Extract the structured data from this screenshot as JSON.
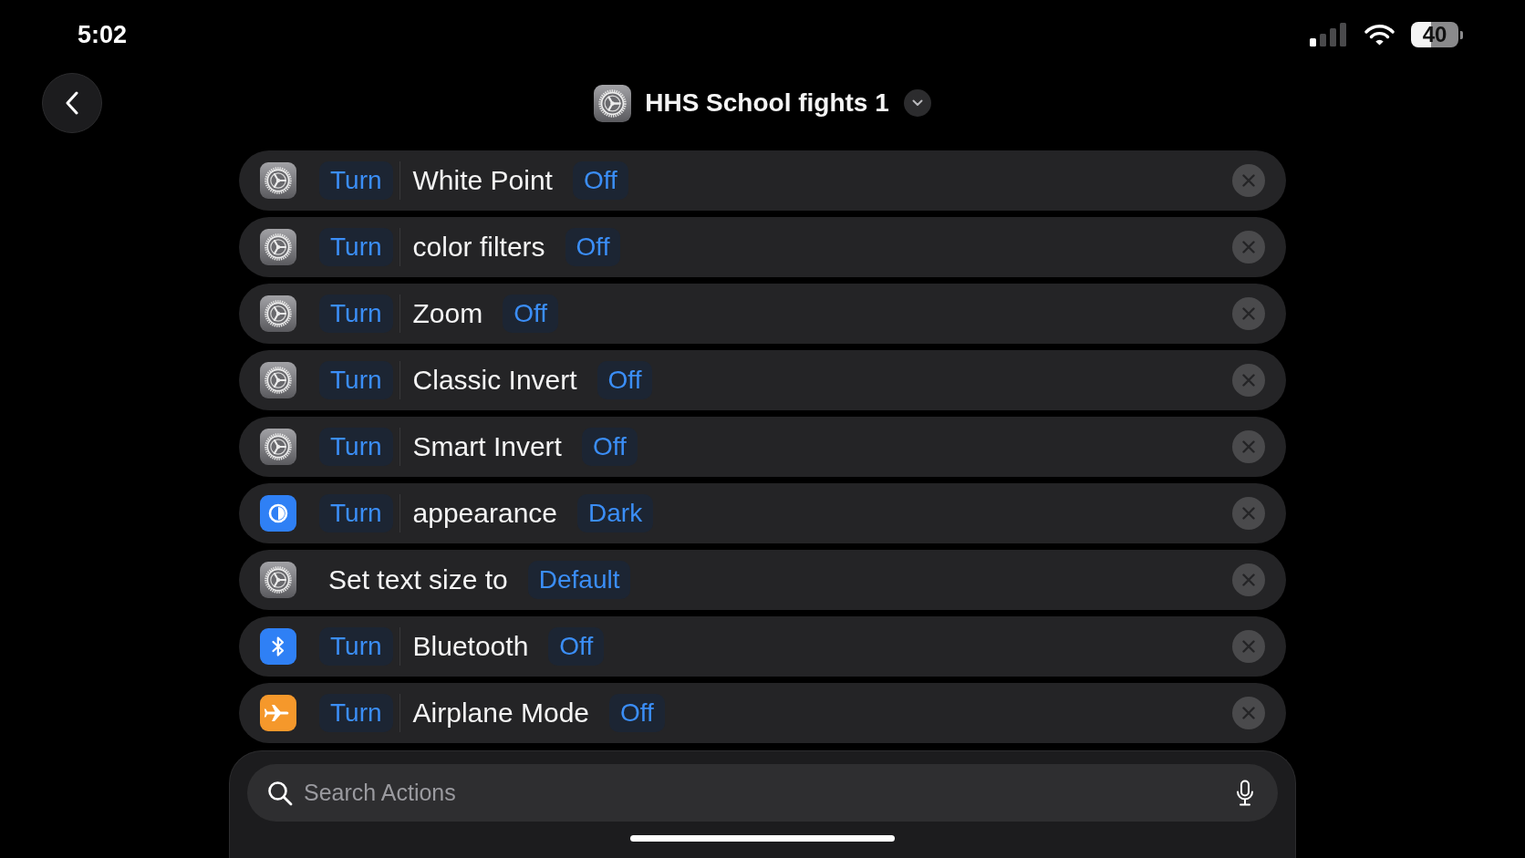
{
  "status_bar": {
    "time": "5:02",
    "battery": "40"
  },
  "header": {
    "title": "HHS School fights 1"
  },
  "actions": [
    {
      "kind": "settings",
      "verb": "Turn",
      "label": "White Point",
      "value": "Off"
    },
    {
      "kind": "settings",
      "verb": "Turn",
      "label": "color filters",
      "value": "Off"
    },
    {
      "kind": "settings",
      "verb": "Turn",
      "label": "Zoom",
      "value": "Off"
    },
    {
      "kind": "settings",
      "verb": "Turn",
      "label": "Classic Invert",
      "value": "Off"
    },
    {
      "kind": "settings",
      "verb": "Turn",
      "label": "Smart Invert",
      "value": "Off"
    },
    {
      "kind": "appearance",
      "verb": "Turn",
      "label": "appearance",
      "value": "Dark"
    },
    {
      "kind": "settings",
      "phrase": "Set text size to",
      "value": "Default"
    },
    {
      "kind": "bluetooth",
      "verb": "Turn",
      "label": "Bluetooth",
      "value": "Off"
    },
    {
      "kind": "airplane",
      "verb": "Turn",
      "label": "Airplane Mode",
      "value": "Off"
    }
  ],
  "search": {
    "placeholder": "Search Actions"
  }
}
